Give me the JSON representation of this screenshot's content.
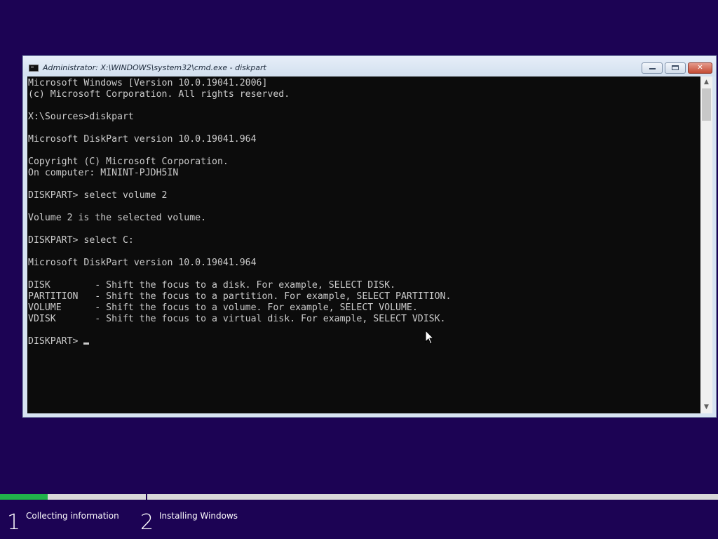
{
  "window": {
    "title": "Administrator: X:\\WINDOWS\\system32\\cmd.exe - diskpart",
    "controls": {
      "minimize": "",
      "maximize": "",
      "close": "✕"
    }
  },
  "console": {
    "lines": [
      "Microsoft Windows [Version 10.0.19041.2006]",
      "(c) Microsoft Corporation. All rights reserved.",
      "",
      "X:\\Sources>diskpart",
      "",
      "Microsoft DiskPart version 10.0.19041.964",
      "",
      "Copyright (C) Microsoft Corporation.",
      "On computer: MININT-PJDH5IN",
      "",
      "DISKPART> select volume 2",
      "",
      "Volume 2 is the selected volume.",
      "",
      "DISKPART> select C:",
      "",
      "Microsoft DiskPart version 10.0.19041.964",
      "",
      "DISK        - Shift the focus to a disk. For example, SELECT DISK.",
      "PARTITION   - Shift the focus to a partition. For example, SELECT PARTITION.",
      "VOLUME      - Shift the focus to a volume. For example, SELECT VOLUME.",
      "VDISK       - Shift the focus to a virtual disk. For example, SELECT VDISK.",
      ""
    ],
    "prompt": "DISKPART> "
  },
  "scrollbar": {
    "up_icon": "▲",
    "down_icon": "▼"
  },
  "setup": {
    "progress_fraction": 0.066,
    "steps": [
      {
        "number": "1",
        "label": "Collecting information"
      },
      {
        "number": "2",
        "label": "Installing Windows"
      }
    ]
  },
  "colors": {
    "background": "#1c0354",
    "console_bg": "#0c0c0c",
    "console_text": "#cccccc",
    "progress": "#21b24b"
  }
}
